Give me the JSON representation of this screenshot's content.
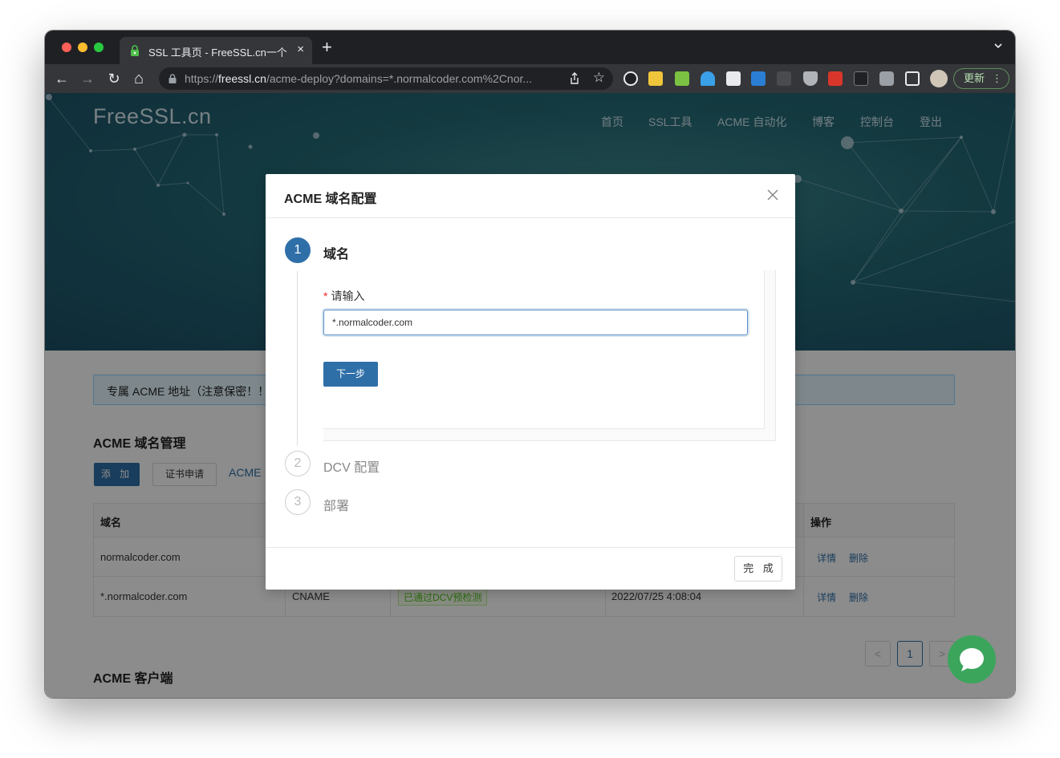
{
  "browser": {
    "tab_title": "SSL 工具页 - FreeSSL.cn一个提",
    "tab_close": "×",
    "new_tab": "+",
    "url_prefix": "https://",
    "url_domain": "freessl.cn",
    "url_path": "/acme-deploy?domains=*.normalcoder.com%2Cnor...",
    "update_label": "更新",
    "update_menu": "⋮",
    "nav_back": "←",
    "nav_forward": "→",
    "nav_reload": "↻",
    "nav_home": "⌂",
    "star": "☆"
  },
  "site": {
    "logo": "FreeSSL.cn",
    "nav": [
      "首页",
      "SSL工具",
      "ACME 自动化",
      "博客",
      "控制台",
      "登出"
    ]
  },
  "page": {
    "alert_text": "专属 ACME 地址（注意保密！！",
    "domain_mgmt_title": "ACME 域名管理",
    "add_button": "添 加",
    "cert_button": "证书申请",
    "acme_link": "ACME",
    "table": {
      "headers": [
        "域名",
        "操作"
      ],
      "rows": [
        {
          "domain": "normalcoder.com",
          "type": "",
          "status": "",
          "time": "",
          "detail": "详情",
          "delete": "删除"
        },
        {
          "domain": "*.normalcoder.com",
          "type": "CNAME",
          "status": "已通过DCV预检测",
          "time": "2022/07/25 4:08:04",
          "detail": "详情",
          "delete": "删除"
        }
      ]
    },
    "pager": {
      "prev": "<",
      "current": "1",
      "next": ">"
    },
    "client_title": "ACME 客户端"
  },
  "modal": {
    "title": "ACME 域名配置",
    "steps": [
      {
        "number": "1",
        "label": "域名"
      },
      {
        "number": "2",
        "label": "DCV 配置"
      },
      {
        "number": "3",
        "label": "部署"
      }
    ],
    "field_required": "*",
    "field_label": "请输入",
    "domain_value": "*.normalcoder.com",
    "next_button": "下一步",
    "done_button": "完 成"
  },
  "colors": {
    "primary": "#2f6fa8",
    "success": "#52c41a",
    "chat": "#3ba55c"
  }
}
